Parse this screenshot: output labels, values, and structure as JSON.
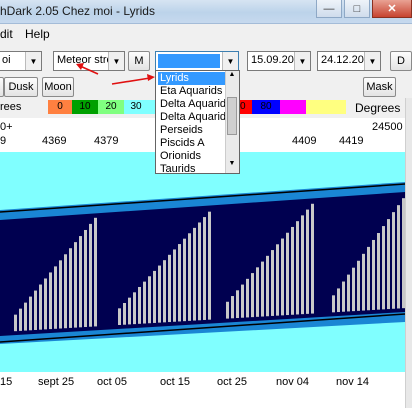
{
  "titlebar": {
    "title": "hDark 2.05  Chez moi  -  Lyrids"
  },
  "menu": {
    "items": [
      "dit",
      "Help"
    ]
  },
  "toolbar": {
    "location_combo": "oi",
    "type_combo": "Meteor stre",
    "m_button": "M",
    "shower_combo": "",
    "start_date": "15.09.20",
    "end_date": "24.12.20",
    "right_button": "D"
  },
  "toolbar2": {
    "left_button": "",
    "dusk_button": "Dusk",
    "moon_button": "Moon",
    "mask_button": "Mask"
  },
  "dropdown": {
    "items": [
      "Lyrids",
      "Eta Aquarids",
      "Delta Aquarid",
      "Delta Aquarid",
      "Perseids",
      "Piscids A",
      "Orionids",
      "Taurids"
    ],
    "selected_index": 0
  },
  "color_scale": {
    "left_label": "rees",
    "right_label": "Degrees",
    "swatches": [
      {
        "label": "0",
        "color": "#ff8040"
      },
      {
        "label": "10",
        "color": "#00a000"
      },
      {
        "label": "20",
        "color": "#80ff80"
      },
      {
        "label": "30",
        "color": "#80ffff"
      },
      {
        "label": "",
        "color": "#80ffff"
      },
      {
        "label": "70",
        "color": "#ff0000"
      },
      {
        "label": "80",
        "color": "#0000ff"
      },
      {
        "label": "",
        "color": "#ff00ff"
      },
      {
        "label": "",
        "color": "#ffff80"
      }
    ]
  },
  "julian_days": {
    "prefix_top": "0+",
    "prefix_bottom": "9",
    "right_top": "24500",
    "values": [
      "4369",
      "4379",
      "4409",
      "4419"
    ]
  },
  "date_axis": [
    "15",
    "sept 25",
    "oct 05",
    "oct 15",
    "oct 25",
    "nov 04",
    "nov 14"
  ],
  "colors": {
    "sky_day": "#80ffff",
    "twilight": "#1a86d4",
    "night": "#000050",
    "moon_stripes": "#c8c8c8",
    "annotation_arrow": "#e01010"
  }
}
